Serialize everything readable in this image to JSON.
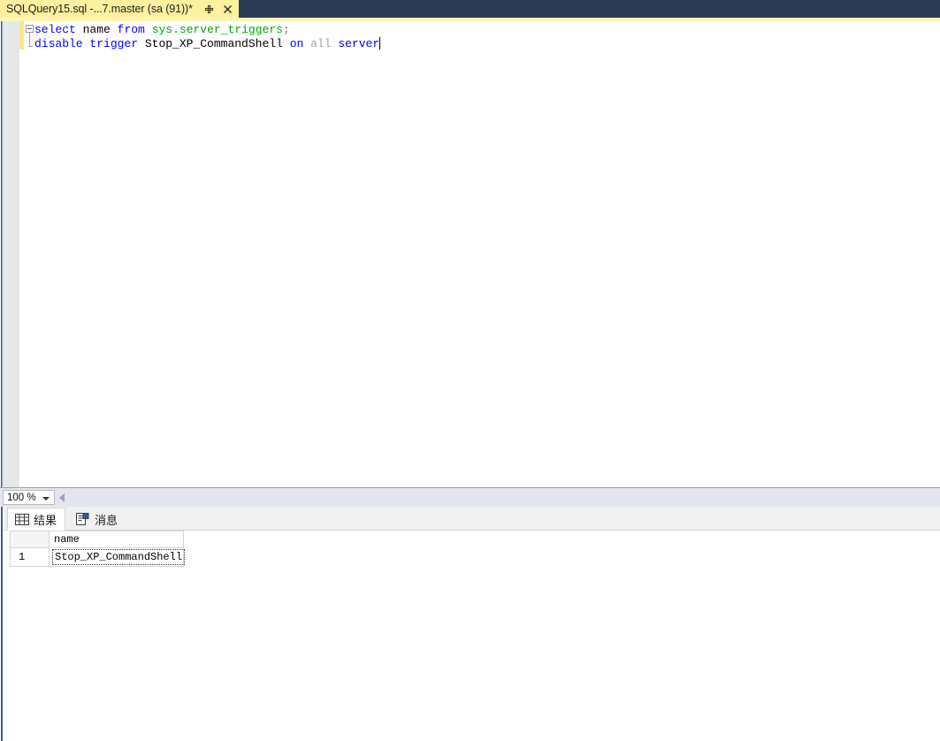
{
  "window": {
    "tab": {
      "title": "SQLQuery15.sql -...7.master (sa (91))*",
      "pin_icon": "pin-icon",
      "close_icon": "close-icon"
    },
    "accent_dark": "#2b3a53",
    "accent_yellow": "#fdf0a0"
  },
  "editor": {
    "outline_state": "expanded",
    "line1": {
      "kw_select": "select",
      "sp1": " ",
      "id_name": "name",
      "sp2": " ",
      "kw_from": "from",
      "sp3": " ",
      "obj_schema": "sys",
      "punc_dot": ".",
      "obj_table": "server_triggers",
      "punc_semicolon": ";"
    },
    "line2": {
      "kw_disable": "disable",
      "sp1": " ",
      "kw_trigger": "trigger",
      "sp2": " ",
      "id_trigger_name": "Stop_XP_CommandShell",
      "sp3": " ",
      "kw_on": "on",
      "sp4": " ",
      "dim_all": "all",
      "sp5": " ",
      "kw_server": "server"
    }
  },
  "zoombar": {
    "zoom_value": "100 %",
    "dropdown_icon": "chevron-down-icon",
    "scroll_left_icon": "scroll-left-arrow-icon"
  },
  "results": {
    "tabs": [
      {
        "label": "结果",
        "icon": "grid-icon",
        "active": true
      },
      {
        "label": "消息",
        "icon": "message-icon",
        "active": false
      }
    ],
    "grid": {
      "corner_label": "",
      "columns": [
        "name"
      ],
      "rows": [
        {
          "num": "1",
          "cells": [
            "Stop_XP_CommandShell"
          ]
        }
      ]
    }
  }
}
